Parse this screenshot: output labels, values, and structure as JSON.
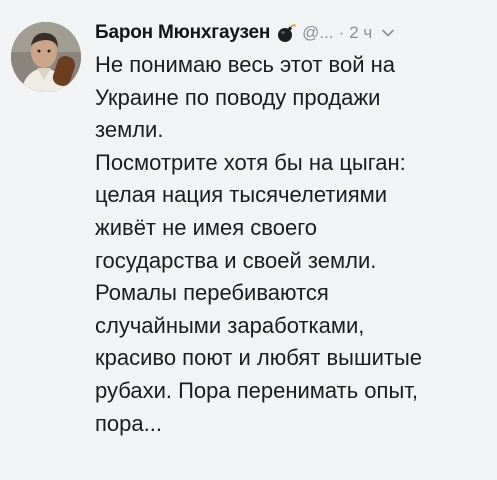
{
  "tweet": {
    "author_name": "Барон Мюнхгаузен",
    "handle": "@...",
    "separator": "·",
    "time": "2 ч",
    "avatar_icon": "avatar-photo",
    "badge_icon": "bomb-icon",
    "menu_icon": "chevron-down-icon",
    "text_lines": [
      "Не понимаю весь этот вой на",
      "Украине по поводу продажи",
      "земли.",
      "Посмотрите хотя бы на цыган:",
      "целая нация тысячелетиями",
      "живёт не имея своего",
      "государства и своей земли.",
      "Ромалы перебиваются",
      "случайными заработками,",
      "красиво поют и любят вышитые",
      "рубахи. Пора перенимать опыт,",
      "пора..."
    ]
  },
  "colors": {
    "background": "#f2f3f4",
    "text": "#1c1c1c",
    "muted": "#8a9097"
  }
}
